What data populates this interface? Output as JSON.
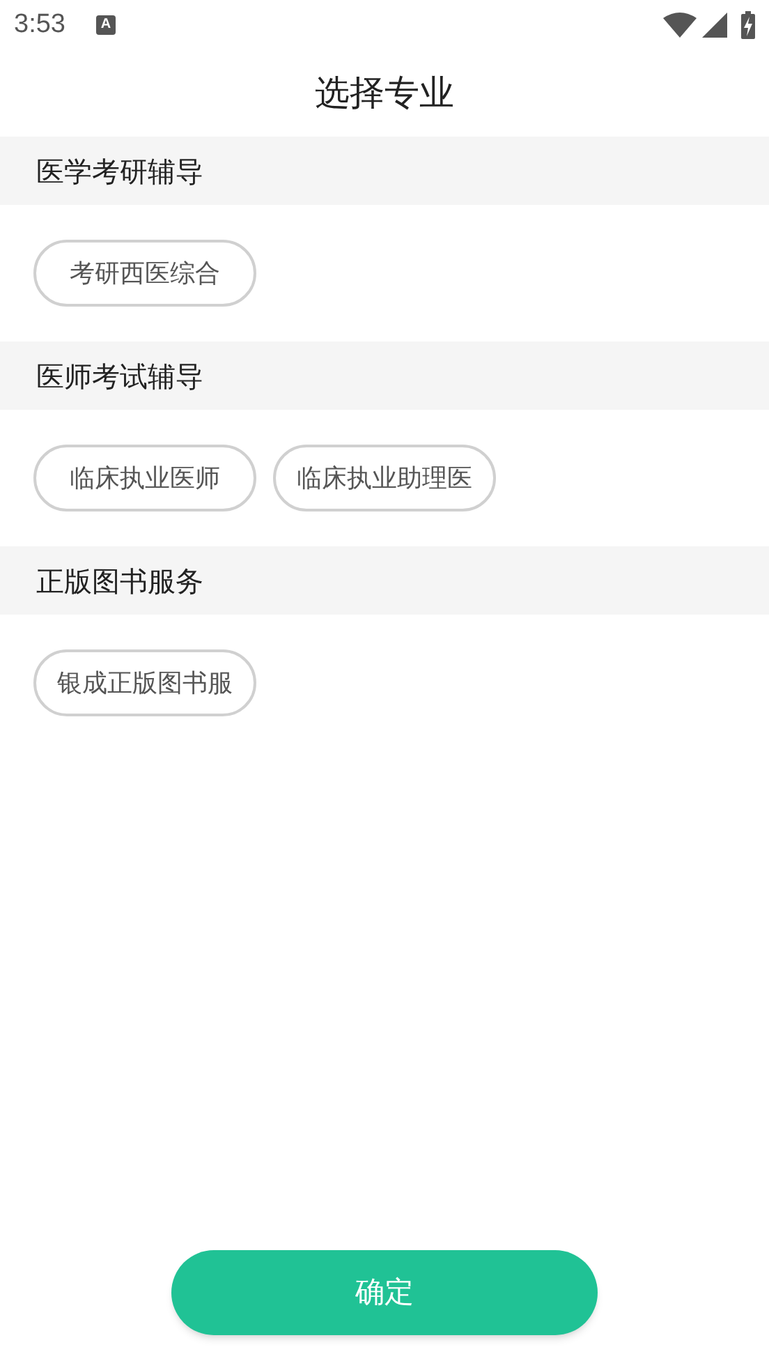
{
  "status_bar": {
    "time": "3:53",
    "notification": "A"
  },
  "title": "选择专业",
  "sections": [
    {
      "title": "医学考研辅导",
      "options": [
        {
          "label": "考研西医综合",
          "selected": false
        }
      ]
    },
    {
      "title": "医师考试辅导",
      "options": [
        {
          "label": "临床执业医师",
          "selected": false
        },
        {
          "label": "临床执业助理医",
          "selected": false
        }
      ]
    },
    {
      "title": "正版图书服务",
      "options": [
        {
          "label": "银成正版图书服",
          "selected": false
        }
      ]
    }
  ],
  "confirm_button": "确定"
}
